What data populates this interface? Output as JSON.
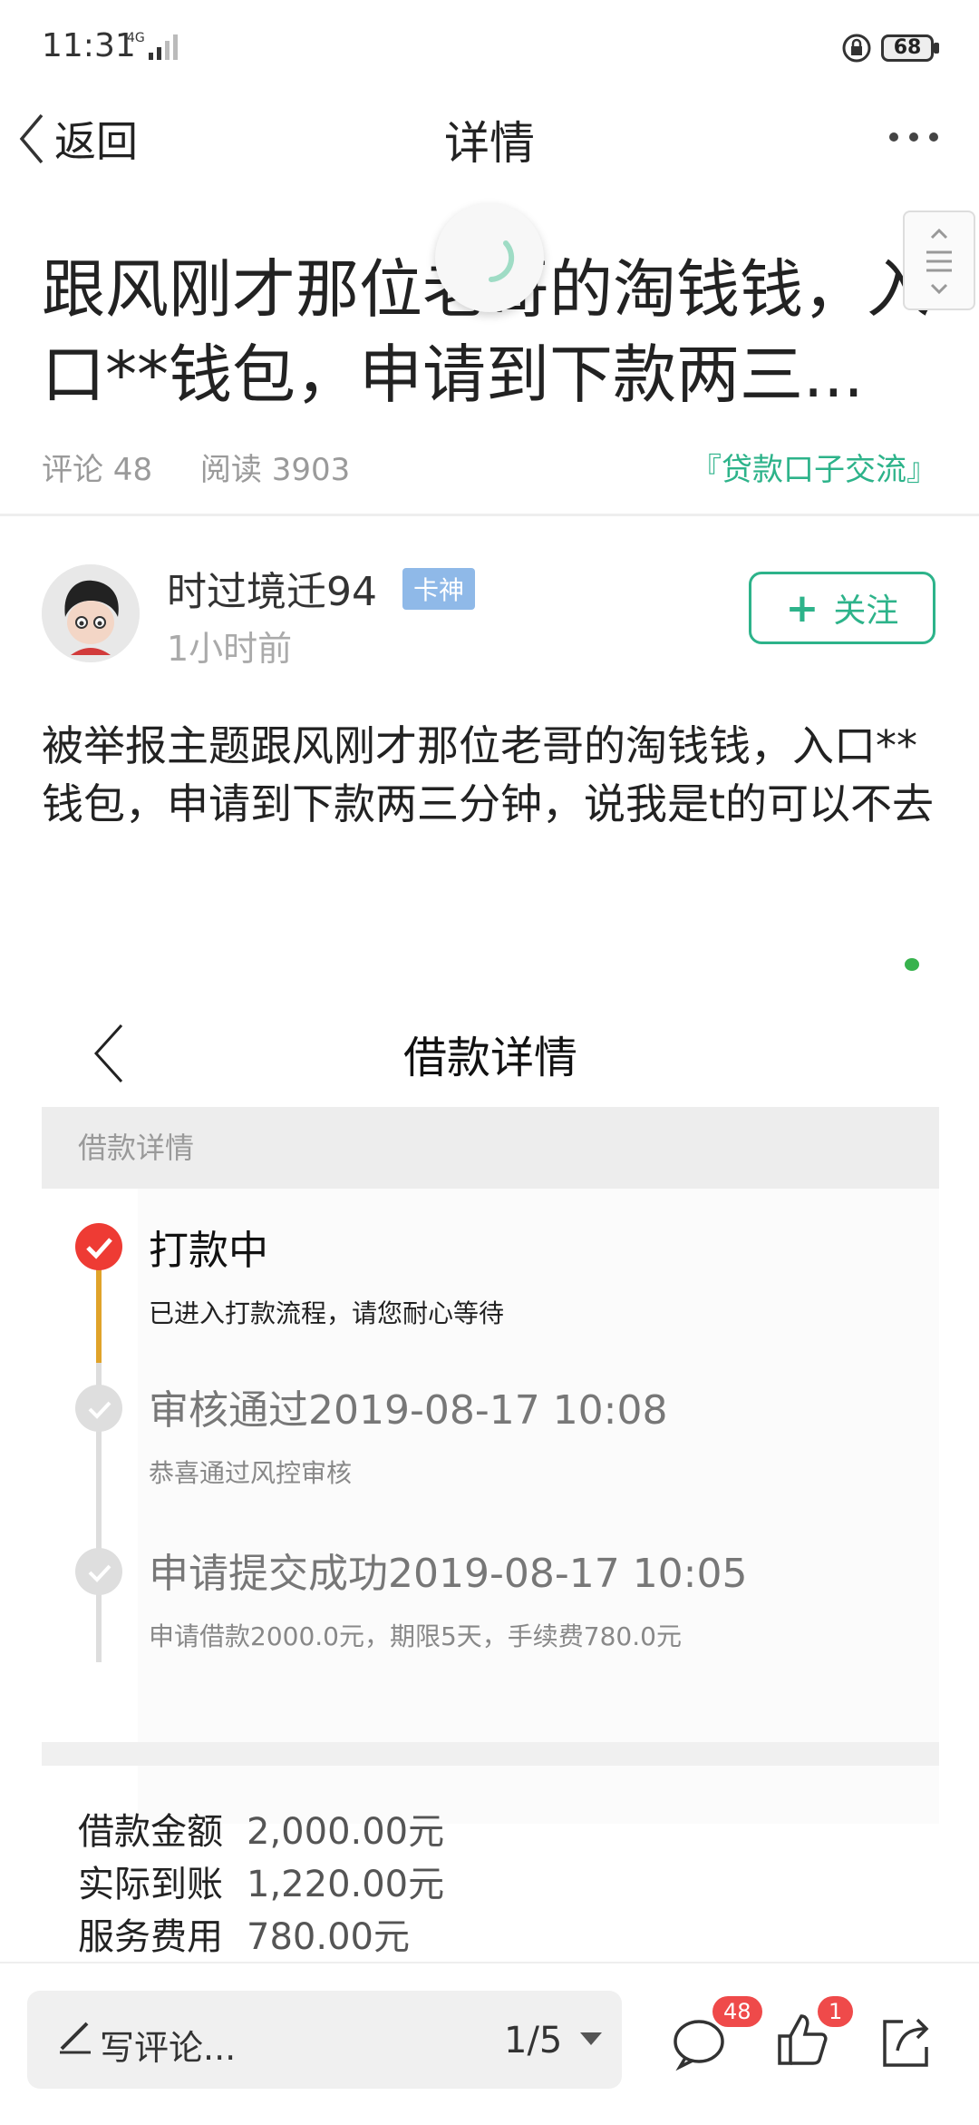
{
  "status_bar": {
    "time": "11:31",
    "network": "4G",
    "battery": "68"
  },
  "nav": {
    "back_label": "返回",
    "title": "详情"
  },
  "post": {
    "title": "跟风刚才那位老哥的淘钱钱，入口**钱包，申请到下款两三...",
    "comments_label": "评论 48",
    "reads_label": "阅读 3903",
    "forum_tag": "『贷款口子交流』",
    "body": "被举报主题跟风刚才那位老哥的淘钱钱，入口**钱包，申请到下款两三分钟，说我是t的可以不去"
  },
  "author": {
    "name": "时过境迁94",
    "badge": "卡神",
    "time": "1小时前",
    "follow_label": "关注"
  },
  "screenshot": {
    "title": "借款详情",
    "section_label": "借款详情",
    "timeline": [
      {
        "title": "打款中",
        "desc": "已进入打款流程，请您耐心等待",
        "state": "active"
      },
      {
        "title": "审核通过2019-08-17 10:08",
        "desc": "恭喜通过风控审核",
        "state": "done"
      },
      {
        "title": "申请提交成功2019-08-17 10:05",
        "desc": "申请借款2000.0元，期限5天，手续费780.0元",
        "state": "done"
      }
    ],
    "amounts": [
      {
        "label": "借款金额",
        "value": "2,000.00元"
      },
      {
        "label": "实际到账",
        "value": "1,220.00元"
      },
      {
        "label": "服务费用",
        "value": "780.00元"
      }
    ]
  },
  "bottom_bar": {
    "comment_placeholder": "写评论...",
    "pager": "1/5",
    "comment_count": "48",
    "like_count": "1"
  },
  "colors": {
    "accent": "#2db38a",
    "alert": "#ee3b34",
    "progress": "#e0a32a"
  }
}
